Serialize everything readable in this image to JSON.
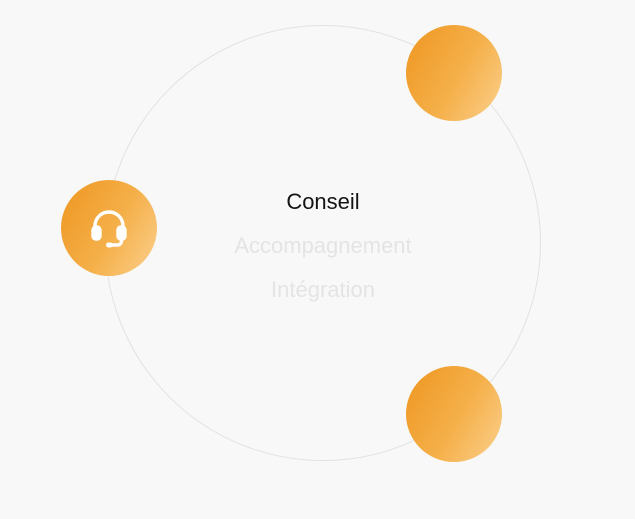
{
  "services": {
    "items": [
      {
        "label": "Conseil",
        "active": true
      },
      {
        "label": "Accompagnement",
        "active": false
      },
      {
        "label": "Intégration",
        "active": false
      }
    ]
  },
  "nodes": {
    "left_icon": "headset-icon"
  },
  "colors": {
    "accent_start": "#ee9620",
    "accent_end": "#fbd08e",
    "active_text": "#141414",
    "inactive_text": "#e4e4e4",
    "ring": "#e2e2e2",
    "background": "#f8f8f8"
  }
}
